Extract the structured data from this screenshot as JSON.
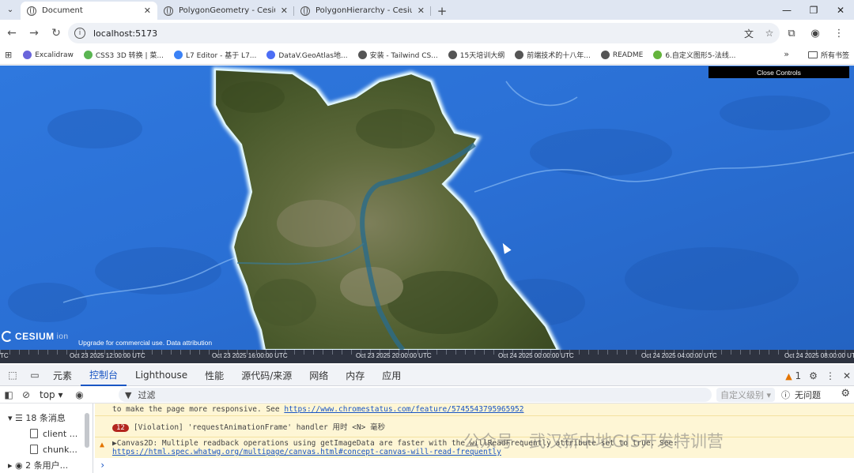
{
  "browser": {
    "tabs": [
      {
        "title": "Document",
        "active": true
      },
      {
        "title": "PolygonGeometry - Cesium ...",
        "active": false
      },
      {
        "title": "PolygonHierarchy - Cesium ...",
        "active": false
      }
    ],
    "new_tab": "+",
    "url": "localhost:5173",
    "bookmarks": [
      {
        "label": "Excalidraw",
        "color": "#6965db"
      },
      {
        "label": "CSS3 3D 转换 | 菜...",
        "color": "#5ab552"
      },
      {
        "label": "L7 Editor - 基于 L7...",
        "color": "#3b82f6"
      },
      {
        "label": "DataV.GeoAtlas地...",
        "color": "#4c6ef5"
      },
      {
        "label": "安装 - Tailwind CS...",
        "color": "#555555"
      },
      {
        "label": "15天培训大纲",
        "color": "#555555"
      },
      {
        "label": "前端技术的十八年...",
        "color": "#555555"
      },
      {
        "label": "README",
        "color": "#555555"
      },
      {
        "label": "6.自定义图形5-法线...",
        "color": "#64b43c"
      }
    ],
    "bookmarks_folder": "所有书签"
  },
  "viewer": {
    "close_controls": "Close Controls",
    "logo_text": "CESIUM",
    "logo_suffix": "ion",
    "credit": "Upgrade for commercial use.  Data attribution",
    "timeline_labels": [
      "TC",
      "Oct 23 2025 12:00:00 UTC",
      "Oct 23 2025 16:00:00 UTC",
      "Oct 23 2025 20:00:00 UTC",
      "Oct 24 2025 00:00:00 UTC",
      "Oct 24 2025 04:00:00 UTC",
      "Oct 24 2025 08:00:00 UTC"
    ],
    "water_color": "#2b72d8",
    "boundary_color": "#dff6ff"
  },
  "devtools": {
    "tabs": [
      "元素",
      "控制台",
      "Lighthouse",
      "性能",
      "源代码/来源",
      "网络",
      "内存",
      "应用"
    ],
    "active_tab": "控制台",
    "warning_count": "1",
    "context": "top",
    "filter_placeholder": "过滤",
    "levels": "自定义级别",
    "issues": "无问题",
    "sidebar": {
      "messages": "18 条消息",
      "files": [
        "client ...",
        "chunk..."
      ],
      "users": "2 条用户..."
    },
    "messages": [
      {
        "text": "to make the page more responsive. See ",
        "link": "https://www.chromestatus.com/feature/5745543795965952"
      },
      {
        "badge": "12",
        "text": "[Violation] 'requestAnimationFrame' handler 用时 <N> 毫秒"
      },
      {
        "text": "▶Canvas2D: Multiple readback operations using getImageData are faster with the willReadFrequently attribute set to true. See:",
        "link": "https://html.spec.whatwg.org/multipage/canvas.html#concept-canvas-will-read-frequently"
      }
    ]
  },
  "watermark": "公众号 · 武汉新中地GIS开发特训营"
}
